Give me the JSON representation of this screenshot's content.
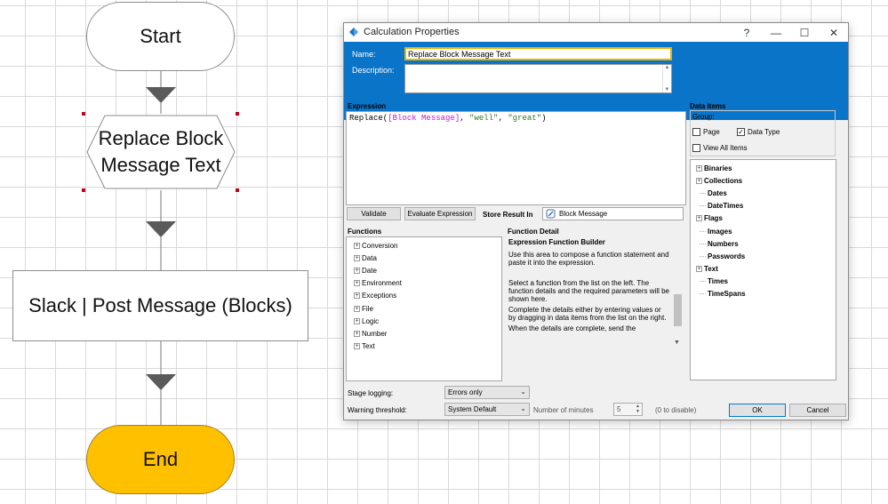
{
  "flowchart": {
    "start_label": "Start",
    "calc_stage_label": "Replace Block Message Text",
    "action_stage_label": "Slack | Post Message (Blocks)",
    "end_label": "End",
    "colors": {
      "end_fill": "#ffc000",
      "arrow": "#5a5a5a",
      "selection": "#c0001c"
    }
  },
  "dialog": {
    "title": "Calculation Properties",
    "title_buttons": {
      "help": "?",
      "minimize": "—",
      "maximize": "☐",
      "close": "✕"
    },
    "name_label": "Name:",
    "name_value": "Replace Block Message Text",
    "description_label": "Description:",
    "description_value": "",
    "expression": {
      "label": "Expression",
      "tokens": {
        "fn": "Replace(",
        "item": "[Block Message]",
        "sep1": ", ",
        "arg2": "\"well\"",
        "sep2": ", ",
        "arg3": "\"great\"",
        "close": ")"
      }
    },
    "validate_button": "Validate",
    "evaluate_button": "Evaluate Expression",
    "store_result_label": "Store Result In",
    "store_result_value": "Block Message",
    "functions": {
      "label": "Functions",
      "items": [
        "Conversion",
        "Data",
        "Date",
        "Environment",
        "Exceptions",
        "File",
        "Logic",
        "Number",
        "Text"
      ]
    },
    "function_detail": {
      "label": "Function Detail",
      "heading": "Expression Function Builder",
      "intro": "Use this area to compose a function statement and paste it into the expression.",
      "para1": "Select a function from the list on the left. The function details and the required parameters will be shown here.",
      "para2": "Complete the details either by entering values or by dragging in data items from the list on the right.",
      "para3": "When the details are complete, send the"
    },
    "data_items": {
      "label": "Data Items",
      "group_label": "Group:",
      "page_checkbox": {
        "label": "Page",
        "checked": false
      },
      "data_type_checkbox": {
        "label": "Data Type",
        "checked": true
      },
      "view_all_checkbox": {
        "label": "View All Items",
        "checked": false
      },
      "types": [
        {
          "name": "Binaries",
          "expandable": true
        },
        {
          "name": "Collections",
          "expandable": true
        },
        {
          "name": "Dates",
          "expandable": false
        },
        {
          "name": "DateTimes",
          "expandable": false
        },
        {
          "name": "Flags",
          "expandable": true
        },
        {
          "name": "Images",
          "expandable": false
        },
        {
          "name": "Numbers",
          "expandable": false
        },
        {
          "name": "Passwords",
          "expandable": false
        },
        {
          "name": "Text",
          "expandable": true
        },
        {
          "name": "Times",
          "expandable": false
        },
        {
          "name": "TimeSpans",
          "expandable": false
        }
      ]
    },
    "stage_logging": {
      "label": "Stage logging:",
      "value": "Errors only"
    },
    "warning_threshold": {
      "label": "Warning threshold:",
      "value": "System Default",
      "minutes_label": "Number of minutes",
      "minutes_value": "5",
      "hint": "(0 to disable)"
    },
    "ok_button": "OK",
    "cancel_button": "Cancel",
    "colors": {
      "header_band": "#0a74c8",
      "name_focus": "#e8b400",
      "ok_border": "#0078d7"
    }
  }
}
